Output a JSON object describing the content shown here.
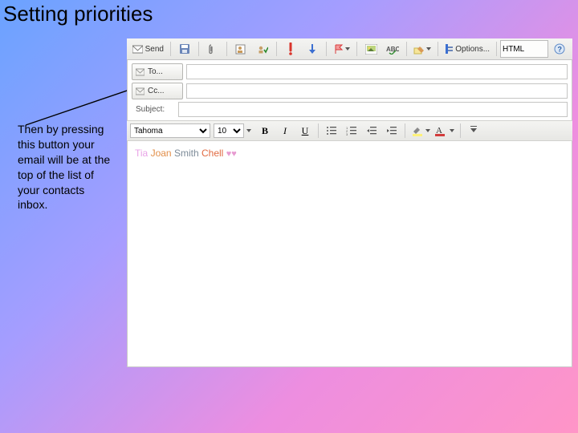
{
  "title": "Setting priorities",
  "description": "Then by pressing this button your email will be at the top of the list of your contacts inbox.",
  "toolbar": {
    "send": "Send",
    "options": "Options...",
    "format_mode": "HTML"
  },
  "address": {
    "to_label": "To...",
    "cc_label": "Cc...",
    "subject_label": "Subject:",
    "to_value": "",
    "cc_value": "",
    "subject_value": ""
  },
  "format": {
    "font_name": "Tahoma",
    "font_size": "10",
    "bold": "B",
    "italic": "I",
    "underline": "U",
    "highlight_swatch": "#fff27a",
    "fontcolor_letter": "A",
    "fontcolor_swatch": "#d23b3b"
  },
  "body": {
    "sig_name1": "Tia",
    "sig_name2": "Joan",
    "sig_name3": "Smith",
    "sig_name4": "Chell",
    "sig_hearts": "♥♥"
  },
  "colors": {
    "priority_flag": "#d9342b"
  }
}
